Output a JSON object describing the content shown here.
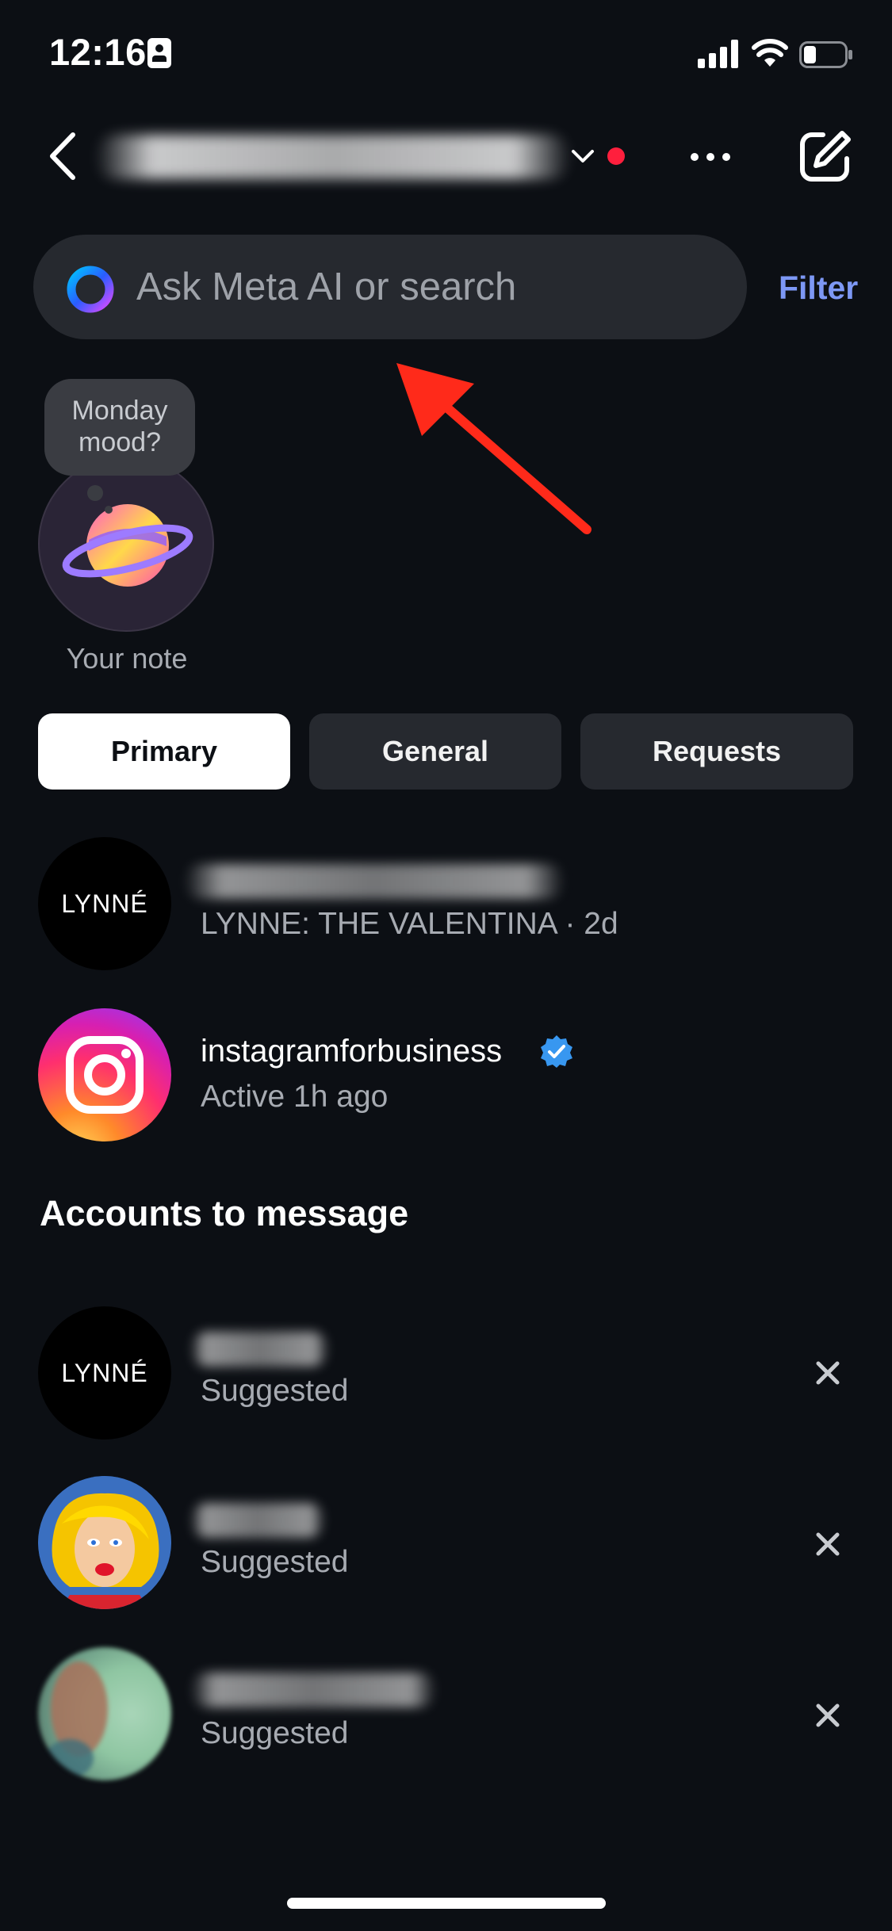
{
  "status_bar": {
    "time": "12:16"
  },
  "header": {
    "account_name_redacted": true
  },
  "search": {
    "placeholder": "Ask Meta AI or search",
    "filter_label": "Filter"
  },
  "note": {
    "bubble_text": "Monday mood?",
    "label": "Your note"
  },
  "tabs": [
    {
      "label": "Primary",
      "selected": true
    },
    {
      "label": "General",
      "selected": false
    },
    {
      "label": "Requests",
      "selected": false
    }
  ],
  "conversations": [
    {
      "avatar_text": "LYNNÉ",
      "name_redacted": true,
      "preview": "LYNNE: THE VALENTINA · 2d"
    },
    {
      "avatar": "instagram-logo",
      "name": "instagramforbusiness",
      "verified": true,
      "preview": "Active 1h ago"
    }
  ],
  "suggestions": {
    "title": "Accounts to message",
    "items": [
      {
        "avatar_text": "LYNNÉ",
        "name_redacted": true,
        "subtitle": "Suggested"
      },
      {
        "avatar": "pop-art-portrait",
        "name_redacted": true,
        "subtitle": "Suggested"
      },
      {
        "avatar": "blurred-photo",
        "name_redacted": true,
        "subtitle": "Suggested"
      }
    ]
  },
  "colors": {
    "background": "#0c0f14",
    "accent_link": "#7d98f5",
    "notification_dot": "#ff1f3d",
    "annotation_arrow": "#ff2a1a",
    "verified_badge": "#3897f0"
  }
}
